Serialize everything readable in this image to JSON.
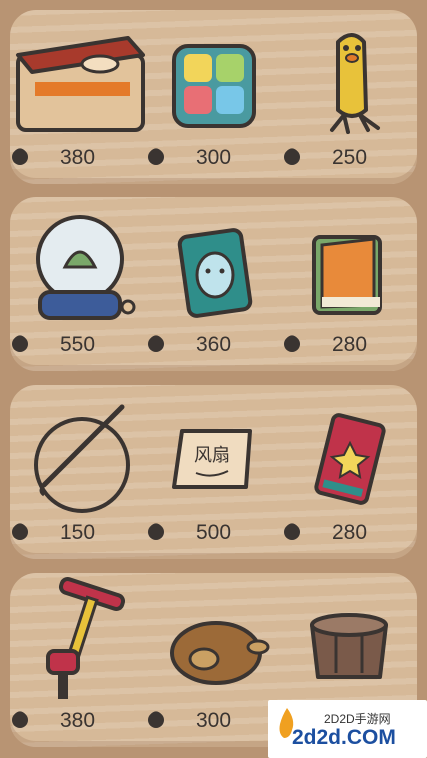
{
  "shelves": [
    {
      "items": [
        {
          "name": "bento-box",
          "price": "380"
        },
        {
          "name": "tile-game",
          "price": "300"
        },
        {
          "name": "yellow-bird-figure",
          "price": "250"
        }
      ]
    },
    {
      "items": [
        {
          "name": "snow-globe",
          "price": "550"
        },
        {
          "name": "face-mask-pack",
          "price": "360"
        },
        {
          "name": "picture-book",
          "price": "280"
        }
      ]
    },
    {
      "items": [
        {
          "name": "knitting-hoop",
          "price": "150"
        },
        {
          "name": "fan-sign",
          "price": "500",
          "sign_text": "风扇"
        },
        {
          "name": "playing-card",
          "price": "280"
        }
      ]
    },
    {
      "items": [
        {
          "name": "pogo-pump",
          "price": "380"
        },
        {
          "name": "roast-chicken",
          "price": "300"
        },
        {
          "name": "wooden-drum",
          "price": ""
        }
      ]
    }
  ],
  "currency_icon": "acorn-icon",
  "watermark": {
    "small": "2D2D手游网",
    "big": "2d2d.COM"
  }
}
